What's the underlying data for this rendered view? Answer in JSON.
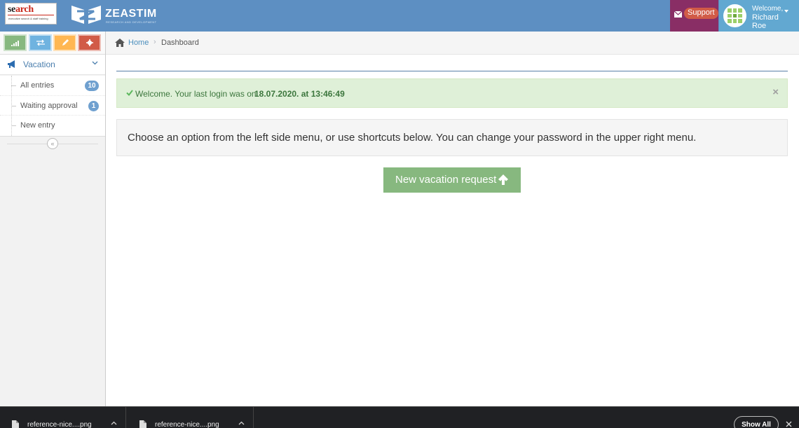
{
  "header": {
    "search_logo_text_a": "se",
    "search_logo_text_b": "arch",
    "search_logo_tagline": "executive search & staff training",
    "brand_name": "ZEASTIM",
    "brand_sub": "RESEARCH AND DEVELOPMENT",
    "support_label": "Support",
    "welcome_small": "Welcome,",
    "user_name": "Richard Roe",
    "colors": {
      "navbar": "#5d8fc2",
      "support": "#892e65",
      "user": "#62a8d1"
    }
  },
  "sidebar": {
    "shortcuts": [
      {
        "icon": "signal-icon",
        "color": "#87b87f"
      },
      {
        "icon": "exchange-icon",
        "color": "#6fb3e0"
      },
      {
        "icon": "pencil-icon",
        "color": "#ffb752"
      },
      {
        "icon": "cog-icon",
        "color": "#d15b47"
      }
    ],
    "menu_label": "Vacation",
    "items": [
      {
        "label": "All entries",
        "count": "10"
      },
      {
        "label": "Waiting approval",
        "count": "1"
      },
      {
        "label": "New entry"
      }
    ],
    "collapse_glyph": "«"
  },
  "breadcrumb": {
    "home": "Home",
    "separator": "›",
    "current": "Dashboard"
  },
  "alert": {
    "text": "Welcome. Your last login was on",
    "date": "18.07.2020. at 13:46:49",
    "close": "×"
  },
  "well": {
    "text": "Choose an option from the left side menu, or use shortcuts below. You can change your password in the upper right menu."
  },
  "cta": {
    "label": "New vacation request"
  },
  "downloads": {
    "items": [
      {
        "name": "reference-nice....png"
      },
      {
        "name": "reference-nice....png"
      }
    ],
    "show_all": "Show All"
  }
}
